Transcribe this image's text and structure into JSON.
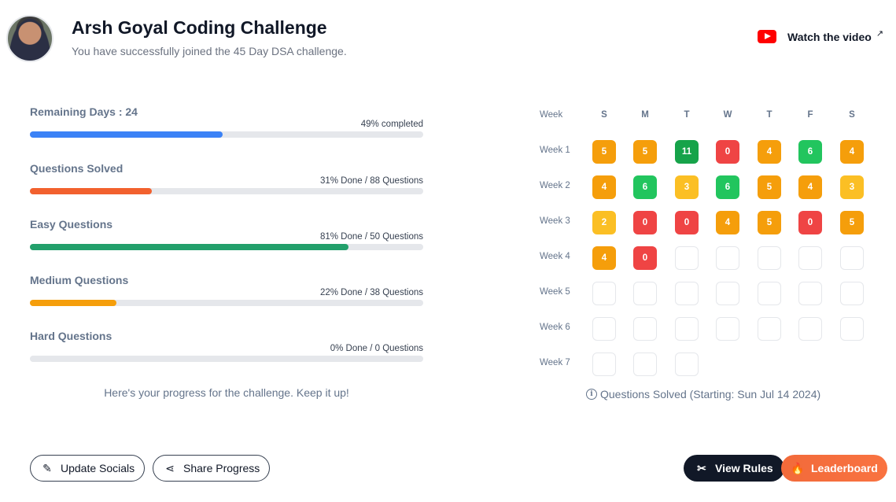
{
  "header": {
    "title": "Arsh Goyal Coding Challenge",
    "subtitle": "You have successfully joined the 45 Day DSA challenge.",
    "watch_label": "Watch the video",
    "watch_icon": "youtube-icon",
    "external_icon": "external-link-icon"
  },
  "progress": [
    {
      "label": "Remaining Days : 24",
      "info": "49% completed",
      "fraction": 0.49,
      "color": "#3b82f6"
    },
    {
      "label": "Questions Solved",
      "info": "31% Done / 88 Questions",
      "fraction": 0.31,
      "color": "#f2612e"
    },
    {
      "label": "Easy Questions",
      "info": "81% Done / 50 Questions",
      "fraction": 0.81,
      "color": "#22a06b"
    },
    {
      "label": "Medium Questions",
      "info": "22% Done / 38 Questions",
      "fraction": 0.22,
      "color": "#f59e0b"
    },
    {
      "label": "Hard Questions",
      "info": "0% Done / 0 Questions",
      "fraction": 0.0,
      "color": "#ef4444"
    }
  ],
  "progress_note": "Here's your progress for the challenge. Keep it up!",
  "calendar": {
    "week_header": "Week",
    "days": [
      "S",
      "M",
      "T",
      "W",
      "T",
      "F",
      "S"
    ],
    "weeks": [
      {
        "label": "Week 1",
        "cells": [
          5,
          5,
          11,
          0,
          4,
          6,
          4
        ]
      },
      {
        "label": "Week 2",
        "cells": [
          4,
          6,
          3,
          6,
          5,
          4,
          3
        ]
      },
      {
        "label": "Week 3",
        "cells": [
          2,
          0,
          0,
          4,
          5,
          0,
          5
        ]
      },
      {
        "label": "Week 4",
        "cells": [
          4,
          0,
          null,
          null,
          null,
          null,
          null
        ]
      },
      {
        "label": "Week 5",
        "cells": [
          null,
          null,
          null,
          null,
          null,
          null,
          null
        ]
      },
      {
        "label": "Week 6",
        "cells": [
          null,
          null,
          null,
          null,
          null,
          null,
          null
        ]
      },
      {
        "label": "Week 7",
        "cells": [
          null,
          null,
          null
        ]
      }
    ],
    "colors": {
      "zero": "#ef4444",
      "low": "#fbbf24",
      "mid": "#f59e0b",
      "high": "#22c55e",
      "max": "#16a34a"
    },
    "legend": "Questions Solved (Starting: Sun Jul 14 2024)"
  },
  "buttons": {
    "update_socials": "Update Socials",
    "share_progress": "Share Progress",
    "view_rules": "View Rules",
    "leaderboard": "Leaderboard"
  }
}
